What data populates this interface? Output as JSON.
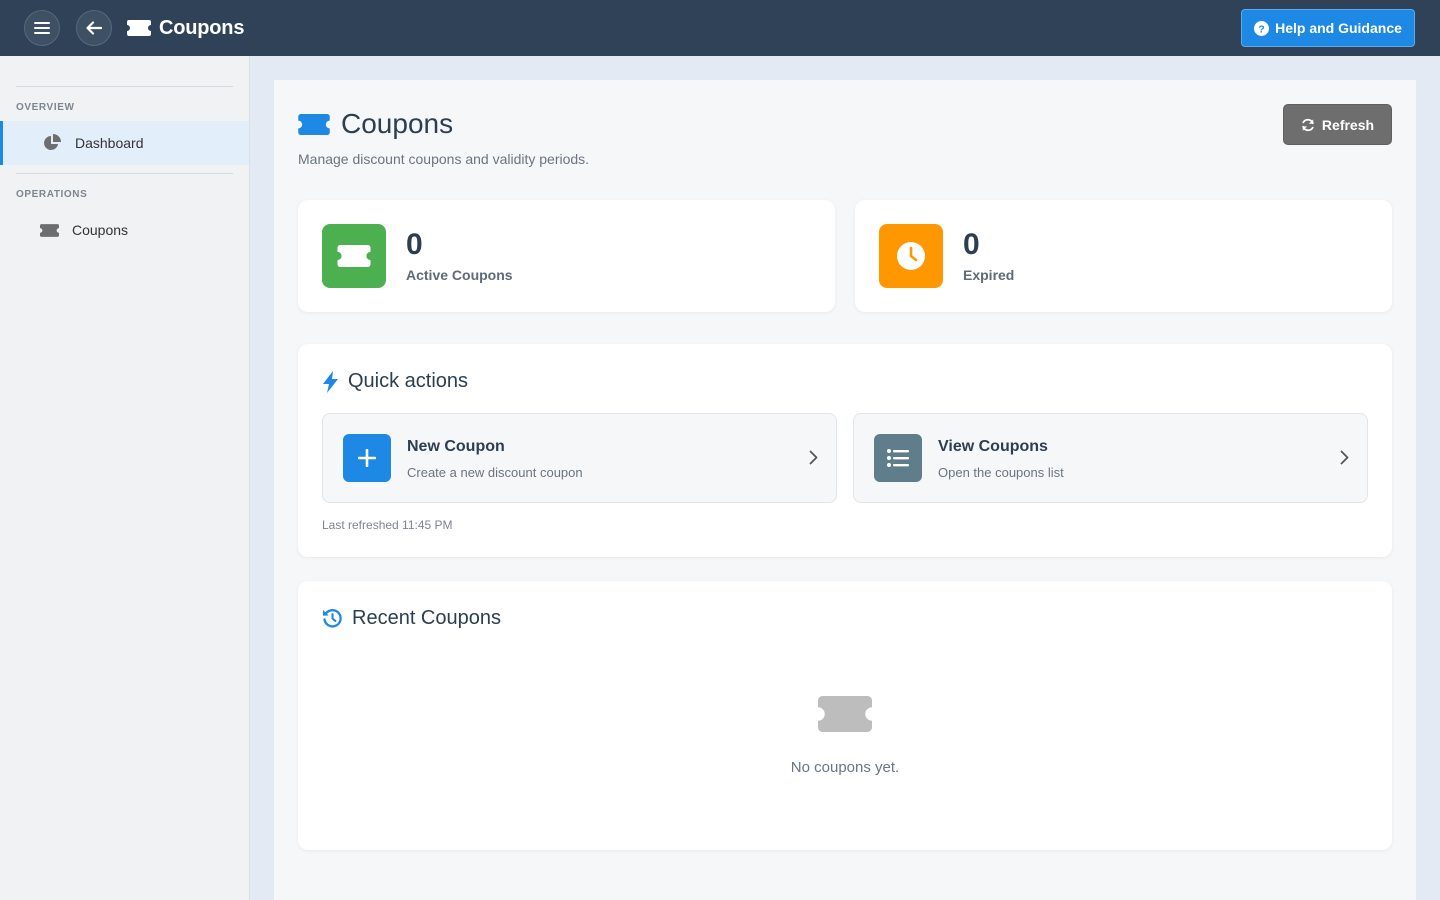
{
  "topbar": {
    "menu_icon": "hamburger-icon",
    "back_icon": "arrow-left-icon",
    "title_icon": "ticket-icon",
    "title": "Coupons",
    "help_icon": "question-circle-icon",
    "help_label": "Help and Guidance"
  },
  "sidebar": {
    "sections": [
      {
        "label": "OVERVIEW",
        "items": [
          {
            "label": "Dashboard",
            "icon": "chart-pie-icon",
            "active": true
          }
        ]
      },
      {
        "label": "OPERATIONS",
        "items": [
          {
            "label": "Coupons",
            "icon": "ticket-icon",
            "active": false
          }
        ]
      }
    ]
  },
  "page": {
    "title": "Coupons",
    "subtitle": "Manage discount coupons and validity periods.",
    "refresh_label": "Refresh",
    "refresh_icon": "sync-icon"
  },
  "stats": [
    {
      "value": "0",
      "label": "Active Coupons",
      "icon": "ticket-icon",
      "color": "#4caf50"
    },
    {
      "value": "0",
      "label": "Expired",
      "icon": "clock-icon",
      "color": "#ff9800"
    }
  ],
  "quick_actions": {
    "title": "Quick actions",
    "icon": "bolt-icon",
    "items": [
      {
        "title": "New Coupon",
        "description": "Create a new discount coupon",
        "icon": "plus-icon",
        "color": "#1e88e5"
      },
      {
        "title": "View Coupons",
        "description": "Open the coupons list",
        "icon": "list-icon",
        "color": "#607d8b"
      }
    ],
    "last_refreshed": "Last refreshed 11:45 PM"
  },
  "recent": {
    "title": "Recent Coupons",
    "icon": "history-icon",
    "empty_icon": "ticket-icon",
    "empty_text": "No coupons yet."
  },
  "colors": {
    "accent": "#1e88e5",
    "topbar": "#2f4257"
  }
}
